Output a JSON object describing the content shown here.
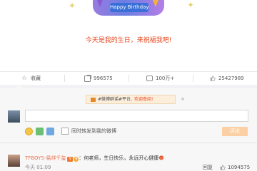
{
  "post": {
    "banner_text": "Happy Birthday",
    "headline": "今天是我的生日，来祝福我吧!"
  },
  "actions": {
    "favorite_label": "收藏",
    "repost_count": "996575",
    "comment_count": "100万+",
    "like_count": "25427989"
  },
  "notice": {
    "prefix": "#微博辟谣#平台,",
    "link": "欢迎查阅!"
  },
  "comment_box": {
    "placeholder": "",
    "same_time_repost_label": "同时转发到我的微博",
    "submit_label": "评论"
  },
  "comments": [
    {
      "username": "TFBOYS-易烊千玺",
      "verified_badge": "V",
      "text": "：何老师，生日快乐，永远开心健康",
      "time": "今天 01:09",
      "reply_label": "回复",
      "likes": "1094575"
    }
  ],
  "colors": {
    "accent": "#eb7350",
    "headline": "#e8461e",
    "button_disabled": "#fcd0a5"
  }
}
